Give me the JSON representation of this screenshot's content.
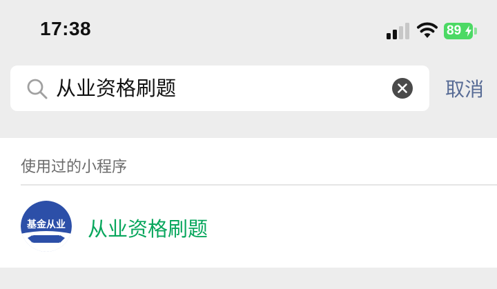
{
  "status_bar": {
    "time": "17:38",
    "battery": "89",
    "icons": [
      "signal-icon",
      "wifi-icon",
      "battery-icon",
      "charging-bolt-icon"
    ]
  },
  "search": {
    "value": "从业资格刷题",
    "icon": "search-icon",
    "clear_icon": "clear-icon",
    "cancel_label": "取消"
  },
  "recent": {
    "header": "使用过的小程序",
    "items": [
      {
        "title": "从业资格刷题",
        "avatar_text": "基金从业",
        "avatar_icon": "mini-program-logo-icon"
      }
    ]
  },
  "colors": {
    "background": "#ededed",
    "link": "#576b95",
    "highlight": "#07a65c",
    "battery": "#4cd964",
    "avatar": "#2c4fa8"
  }
}
